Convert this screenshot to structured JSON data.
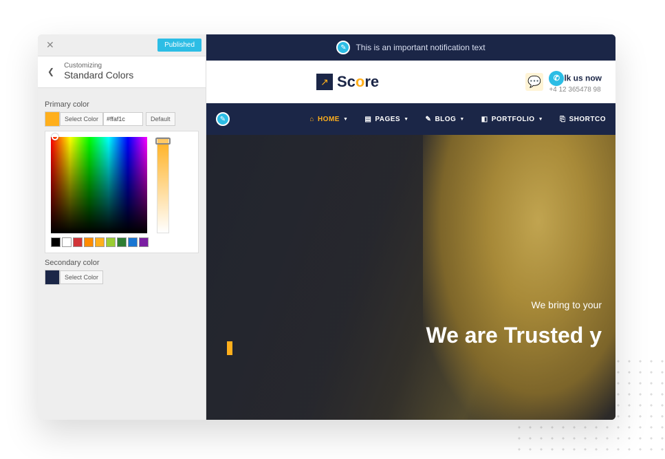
{
  "sidebar": {
    "published_label": "Published",
    "customizing_label": "Customizing",
    "section_title": "Standard Colors",
    "primary": {
      "label": "Primary color",
      "swatch_color": "#ffaf1c",
      "select_label": "Select Color",
      "hex_value": "#ffaf1c",
      "default_label": "Default"
    },
    "secondary": {
      "label": "Secondary color",
      "swatch_color": "#1b2647",
      "select_label": "Select Color"
    },
    "palette": [
      "#000000",
      "#ffffff",
      "#d13438",
      "#ff8c00",
      "#ffaf1c",
      "#9acd32",
      "#2e7d32",
      "#1976d2",
      "#7b1fa2"
    ]
  },
  "preview": {
    "notification_text": "This is an important notification text",
    "logo_text_1": "Sc",
    "logo_text_2": "o",
    "logo_text_3": "re",
    "call_label": "lk us now",
    "phone_number": "+4 12 365478 98",
    "nav": {
      "home": "HOME",
      "pages": "PAGES",
      "blog": "BLOG",
      "portfolio": "PORTFOLIO",
      "shortcode": "SHORTCO"
    },
    "hero": {
      "subline": "We bring to your",
      "headline": "We are Trusted y"
    }
  }
}
